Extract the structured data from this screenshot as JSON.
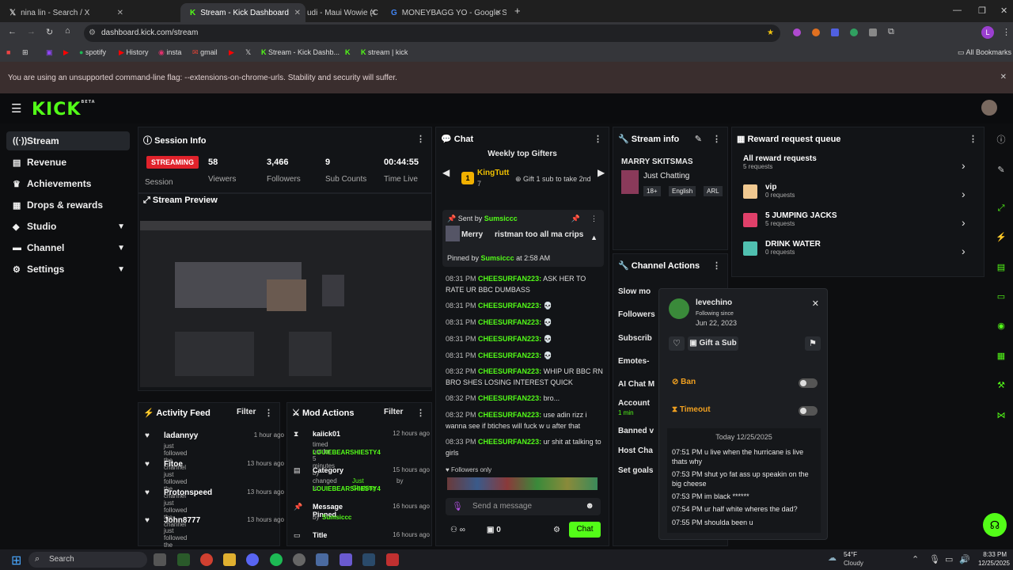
{
  "browser": {
    "tabs": [
      {
        "label": "nina lin - Search / X",
        "icon": "x-icon"
      },
      {
        "label": "Stream - Kick Dashboard",
        "icon": "kick-icon"
      },
      {
        "label": "udi - Maui Wowie (C",
        "icon": ""
      },
      {
        "label": "MONEYBAGG YO - Google Sea",
        "icon": "google-icon"
      }
    ],
    "url": "dashboard.kick.com/stream",
    "bookmarks": [
      "spotify",
      "History",
      "insta",
      "gmail",
      "Stream - Kick Dashb...",
      "stream | kick"
    ],
    "all_bookmarks": "All Bookmarks",
    "warning": "You are using an unsupported command-line flag: --extensions-on-chrome-urls. Stability and security will suffer."
  },
  "kick": {
    "logo": "KICK",
    "beta": "BETA"
  },
  "sidebar": {
    "items": [
      {
        "label": "Stream",
        "icon": "broadcast-icon"
      },
      {
        "label": "Revenue",
        "icon": "revenue-icon"
      },
      {
        "label": "Achievements",
        "icon": "trophy-icon"
      },
      {
        "label": "Drops & rewards",
        "icon": "gift-icon"
      },
      {
        "label": "Studio",
        "icon": "studio-icon"
      },
      {
        "label": "Channel",
        "icon": "channel-icon"
      },
      {
        "label": "Settings",
        "icon": "gear-icon"
      }
    ]
  },
  "session": {
    "title": "Session Info",
    "badge": "STREAMING",
    "badge_label": "Session",
    "stats": [
      {
        "value": "58",
        "label": "Viewers"
      },
      {
        "value": "3,466",
        "label": "Followers"
      },
      {
        "value": "9",
        "label": "Sub Counts"
      },
      {
        "value": "00:44:55",
        "label": "Time Live"
      }
    ],
    "preview_title": "Stream Preview"
  },
  "chat": {
    "title": "Chat",
    "gifters_title": "Weekly top Gifters",
    "gifter_name": "KingTutt",
    "gifter_count": "7",
    "gifter_rank": "1",
    "gift_note": "Gift 1 sub to take 2nd",
    "pinned_sent_by": "Sent by",
    "pinned_sender": "Sumsiccc",
    "pinned_text": "Merry",
    "pinned_text2": "ristman too all ma crips",
    "pinned_by_label": "Pinned by",
    "pinned_by": "Sumsiccc",
    "pinned_at": "at 2:58 AM",
    "messages": [
      {
        "time": "08:31 PM",
        "user": "CHEESURFAN223:",
        "text": "ASK HER TO RATE UR BBC DUMBASS"
      },
      {
        "time": "08:31 PM",
        "user": "CHEESURFAN223:",
        "text": "💀"
      },
      {
        "time": "08:31 PM",
        "user": "CHEESURFAN223:",
        "text": "💀"
      },
      {
        "time": "08:31 PM",
        "user": "CHEESURFAN223:",
        "text": "💀"
      },
      {
        "time": "08:31 PM",
        "user": "CHEESURFAN223:",
        "text": "💀"
      },
      {
        "time": "08:32 PM",
        "user": "CHEESURFAN223:",
        "text": "WHIP UR BBC RN BRO SHES LOSING INTEREST QUICK"
      },
      {
        "time": "08:32 PM",
        "user": "CHEESURFAN223:",
        "text": "bro..."
      },
      {
        "time": "08:32 PM",
        "user": "CHEESURFAN223:",
        "text": "use adin rizz i wanna see if btiches will fuck w u after that"
      },
      {
        "time": "08:33 PM",
        "user": "CHEESURFAN223:",
        "text": "ur shit at talking to girls"
      }
    ],
    "followers_only": "Followers only",
    "placeholder": "Send a message",
    "count": "0",
    "send": "Chat"
  },
  "stream_info": {
    "title": "Stream info",
    "stream_title": "MARRY SKITSMAS",
    "category": "Just Chatting",
    "tags": [
      "18+",
      "English",
      "ARL"
    ]
  },
  "channel_actions": {
    "title": "Channel Actions",
    "items": [
      "Slow mo",
      "Followers",
      "Subscrib",
      "Emotes-",
      "AI Chat M",
      "Account",
      "Banned v",
      "Host Cha",
      "Set goals"
    ],
    "account_sub": "1 min"
  },
  "reward_queue": {
    "title": "Reward request queue",
    "items": [
      {
        "name": "All reward requests",
        "sub": "5 requests"
      },
      {
        "name": "vip",
        "sub": "0 requests"
      },
      {
        "name": "5 JUMPING JACKS",
        "sub": "5 requests"
      },
      {
        "name": "DRINK WATER",
        "sub": "0 requests"
      }
    ]
  },
  "user_card": {
    "name": "levechino",
    "following_label": "Following since",
    "following_date": "Jun 22, 2023",
    "gift": "Gift a Sub",
    "ban": "Ban",
    "timeout": "Timeout",
    "day": "Today 12/25/2025",
    "messages": [
      {
        "time": "07:51 PM",
        "text": "u live when the hurricane is live thats why"
      },
      {
        "time": "07:53 PM",
        "text": "shut yo fat ass up speakin on the big cheese"
      },
      {
        "time": "07:53 PM",
        "text": "im black ******"
      },
      {
        "time": "07:54 PM",
        "text": "ur half white wheres the dad?"
      },
      {
        "time": "07:55 PM",
        "text": "shoulda been u"
      }
    ]
  },
  "activity": {
    "title": "Activity Feed",
    "filter": "Filter",
    "items": [
      {
        "name": "ladannyy",
        "desc": "just followed the channel",
        "time": "1 hour ago"
      },
      {
        "name": "Fitoe",
        "desc": "just followed the channel",
        "time": "13 hours ago"
      },
      {
        "name": "Protonspeed",
        "desc": "just followed the channel",
        "time": "13 hours ago"
      },
      {
        "name": "John8777",
        "desc": "just followed the channel",
        "time": "13 hours ago"
      }
    ]
  },
  "mod": {
    "title": "Mod Actions",
    "filter": "Filter",
    "items": [
      {
        "name": "kaiick01",
        "desc": "timed out for 5 minutes by",
        "by": "LOUIEBEARSHIESTY4",
        "time": "12 hours ago"
      },
      {
        "name": "Category",
        "desc": "changed to",
        "extra": "Just Chatting",
        "extra2": "by",
        "by": "LOUIEBEARSHIESTY4",
        "time": "15 hours ago"
      },
      {
        "name": "Message Pinned",
        "desc": "by",
        "by": "Sumsiccc",
        "time": "16 hours ago"
      },
      {
        "name": "Title",
        "desc": "",
        "by": "",
        "time": "16 hours ago"
      }
    ]
  },
  "taskbar": {
    "search": "Search",
    "weather": "54°F",
    "weather_desc": "Cloudy",
    "time": "8:33 PM",
    "date": "12/25/2025"
  },
  "colors": {
    "accent": "#53fc18",
    "streaming": "#e0222b"
  }
}
